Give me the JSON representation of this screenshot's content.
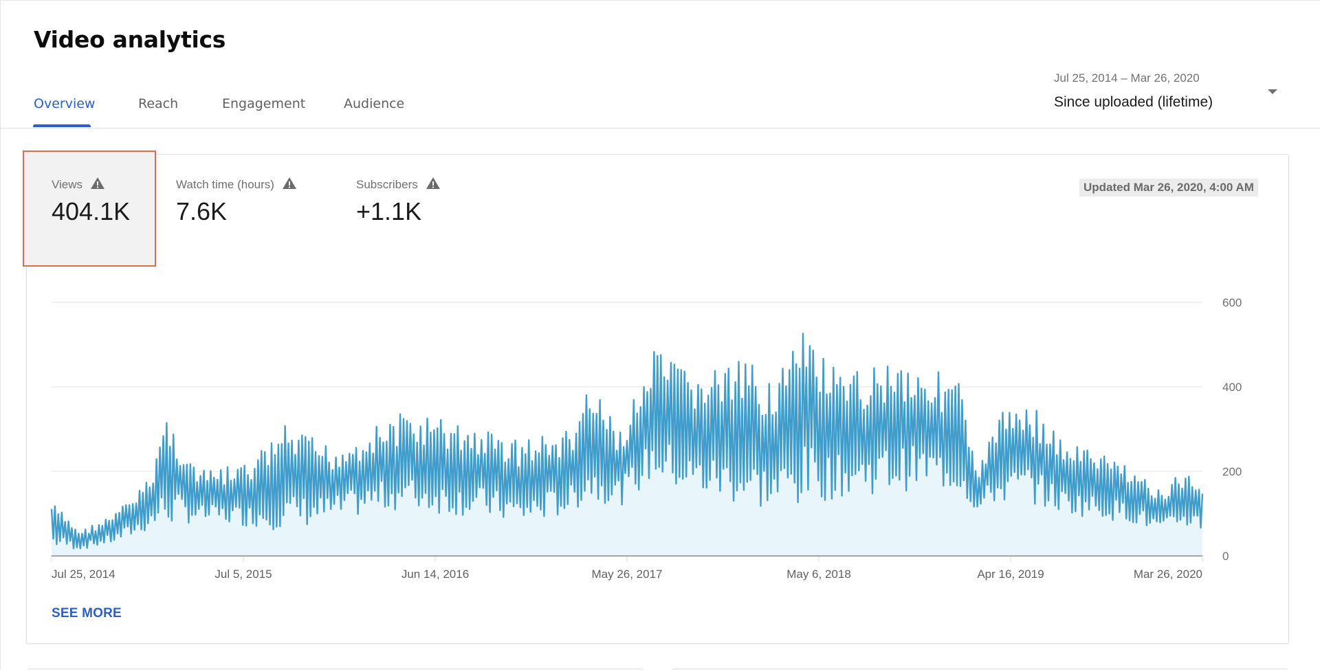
{
  "header": {
    "title": "Video analytics"
  },
  "tabs": [
    {
      "label": "Overview",
      "active": true
    },
    {
      "label": "Reach",
      "active": false
    },
    {
      "label": "Engagement",
      "active": false
    },
    {
      "label": "Audience",
      "active": false
    }
  ],
  "date_picker": {
    "range": "Jul 25, 2014 – Mar 26, 2020",
    "preset": "Since uploaded (lifetime)",
    "icon": "dropdown-arrow-icon"
  },
  "metrics": [
    {
      "label": "Views",
      "value": "404.1K",
      "icon": "warning-icon",
      "selected": true
    },
    {
      "label": "Watch time (hours)",
      "value": "7.6K",
      "icon": "warning-icon",
      "selected": false
    },
    {
      "label": "Subscribers",
      "value": "+1.1K",
      "icon": "warning-icon",
      "selected": false
    }
  ],
  "updated": "Updated Mar 26, 2020, 4:00 AM",
  "see_more": "SEE MORE",
  "colors": {
    "accent": "#2b5fc7",
    "line": "#3f9ccb",
    "area": "#e8f5fa",
    "highlight_border": "#e06c4f",
    "highlight_bg": "#f2f2f2",
    "grid": "#e3e3e3"
  },
  "chart_data": {
    "type": "area",
    "title": "Views",
    "xlabel": "",
    "ylabel": "",
    "ylim": [
      0,
      600
    ],
    "y_ticks": [
      "0",
      "200",
      "400",
      "600"
    ],
    "y_tick_values": [
      0,
      200,
      400,
      600
    ],
    "y_axis_position": "right",
    "grid": true,
    "x_tick_labels": [
      "Jul 25, 2014",
      "Jul 5, 2015",
      "Jun 14, 2016",
      "May 26, 2017",
      "May 6, 2018",
      "Apr 16, 2019",
      "Mar 26, 2020"
    ],
    "x_range": [
      "Jul 25, 2014",
      "Mar 26, 2020"
    ],
    "series": [
      {
        "name": "Views (daily, approximate envelope by period)",
        "period_points": [
          {
            "period": "2014-07",
            "low": 20,
            "high": 130
          },
          {
            "period": "2014-09",
            "low": 15,
            "high": 60
          },
          {
            "period": "2014-11",
            "low": 30,
            "high": 100
          },
          {
            "period": "2015-01",
            "low": 60,
            "high": 180
          },
          {
            "period": "2015-02",
            "low": 70,
            "high": 345
          },
          {
            "period": "2015-04",
            "low": 80,
            "high": 200
          },
          {
            "period": "2015-07",
            "low": 70,
            "high": 220
          },
          {
            "period": "2015-09",
            "low": 60,
            "high": 310
          },
          {
            "period": "2015-12",
            "low": 80,
            "high": 260
          },
          {
            "period": "2016-02",
            "low": 100,
            "high": 300
          },
          {
            "period": "2016-04",
            "low": 110,
            "high": 340
          },
          {
            "period": "2016-06",
            "low": 100,
            "high": 330
          },
          {
            "period": "2016-09",
            "low": 90,
            "high": 300
          },
          {
            "period": "2016-11",
            "low": 70,
            "high": 280
          },
          {
            "period": "2017-02",
            "low": 100,
            "high": 300
          },
          {
            "period": "2017-03",
            "low": 130,
            "high": 410
          },
          {
            "period": "2017-05",
            "low": 120,
            "high": 300
          },
          {
            "period": "2017-07",
            "low": 180,
            "high": 490
          },
          {
            "period": "2017-09",
            "low": 140,
            "high": 440
          },
          {
            "period": "2017-12",
            "low": 120,
            "high": 460
          },
          {
            "period": "2018-02",
            "low": 100,
            "high": 440
          },
          {
            "period": "2018-04",
            "low": 120,
            "high": 540
          },
          {
            "period": "2018-06",
            "low": 140,
            "high": 420
          },
          {
            "period": "2018-09",
            "low": 150,
            "high": 480
          },
          {
            "period": "2018-11",
            "low": 160,
            "high": 450
          },
          {
            "period": "2019-01",
            "low": 150,
            "high": 420
          },
          {
            "period": "2019-02",
            "low": 100,
            "high": 180
          },
          {
            "period": "2019-03",
            "low": 120,
            "high": 330
          },
          {
            "period": "2019-05",
            "low": 130,
            "high": 380
          },
          {
            "period": "2019-07",
            "low": 100,
            "high": 280
          },
          {
            "period": "2019-09",
            "low": 90,
            "high": 250
          },
          {
            "period": "2019-11",
            "low": 80,
            "high": 220
          },
          {
            "period": "2020-01",
            "low": 50,
            "high": 150
          },
          {
            "period": "2020-02",
            "low": 70,
            "high": 200
          },
          {
            "period": "2020-03",
            "low": 60,
            "high": 185
          }
        ]
      }
    ]
  }
}
